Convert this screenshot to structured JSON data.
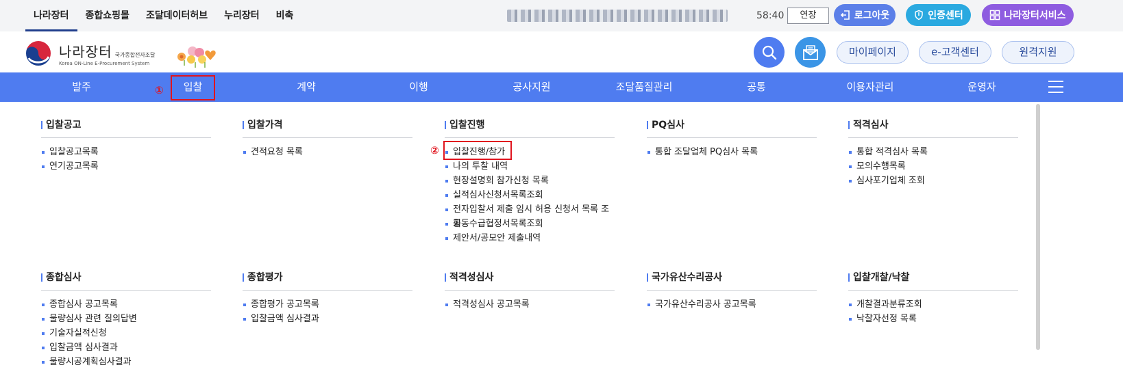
{
  "topbar": {
    "tabs": [
      "나라장터",
      "종합쇼핑몰",
      "조달데이터허브",
      "누리장터",
      "비축"
    ],
    "timer": "58:40",
    "extend_label": "연장",
    "logout_label": "로그아웃",
    "cert_label": "인증센터",
    "service_label": "나라장터서비스",
    "colors": {
      "logout": "#5b7fe8",
      "cert": "#2aa9e0",
      "service": "#8e5ce0"
    }
  },
  "header": {
    "logo_main": "나라장터",
    "logo_sub1": "국가종합전자조달",
    "logo_sub2": "Korea ON-Line E-Procurement System",
    "links": [
      "마이페이지",
      "e-고객센터",
      "원격지원"
    ],
    "icons": [
      "search-icon",
      "mail-icon"
    ]
  },
  "gnb": {
    "accent": "#4f7cf0",
    "items": [
      "발주",
      "입찰",
      "계약",
      "이행",
      "공사지원",
      "조달품질관리",
      "공통",
      "이용자관리",
      "운영자"
    ],
    "marker1": "①",
    "marker2": "②"
  },
  "menu": [
    {
      "title": "입찰공고",
      "items": [
        "입찰공고목록",
        "연기공고목록"
      ]
    },
    {
      "title": "입찰가격",
      "items": [
        "견적요청 목록"
      ]
    },
    {
      "title": "입찰진행",
      "items": [
        "입찰진행/참가",
        "나의 투찰 내역",
        "현장설명회 참가신청 목록",
        "실적심사신청서목록조회",
        "전자입찰서 제출 임시 허용 신청서 목록 조회",
        "공동수급협정서목록조회",
        "제안서/공모안 제출내역"
      ]
    },
    {
      "title": "PQ심사",
      "items": [
        "통합 조달업체 PQ심사 목록"
      ]
    },
    {
      "title": "적격심사",
      "items": [
        "통합 적격심사 목록",
        "모의수행목록",
        "심사포기업체 조회"
      ]
    },
    {
      "title": "종합심사",
      "items": [
        "종합심사 공고목록",
        "물량심사 관련 질의답변",
        "기술자실적신청",
        "입찰금액 심사결과",
        "물량시공계획심사결과"
      ]
    },
    {
      "title": "종합평가",
      "items": [
        "종합평가 공고목록",
        "입찰금액 심사결과"
      ]
    },
    {
      "title": "적격성심사",
      "items": [
        "적격성심사 공고목록"
      ]
    },
    {
      "title": "국가유산수리공사",
      "items": [
        "국가유산수리공사 공고목록"
      ]
    },
    {
      "title": "입찰개찰/낙찰",
      "items": [
        "개찰결과분류조회",
        "낙찰자선정 목록"
      ]
    }
  ]
}
